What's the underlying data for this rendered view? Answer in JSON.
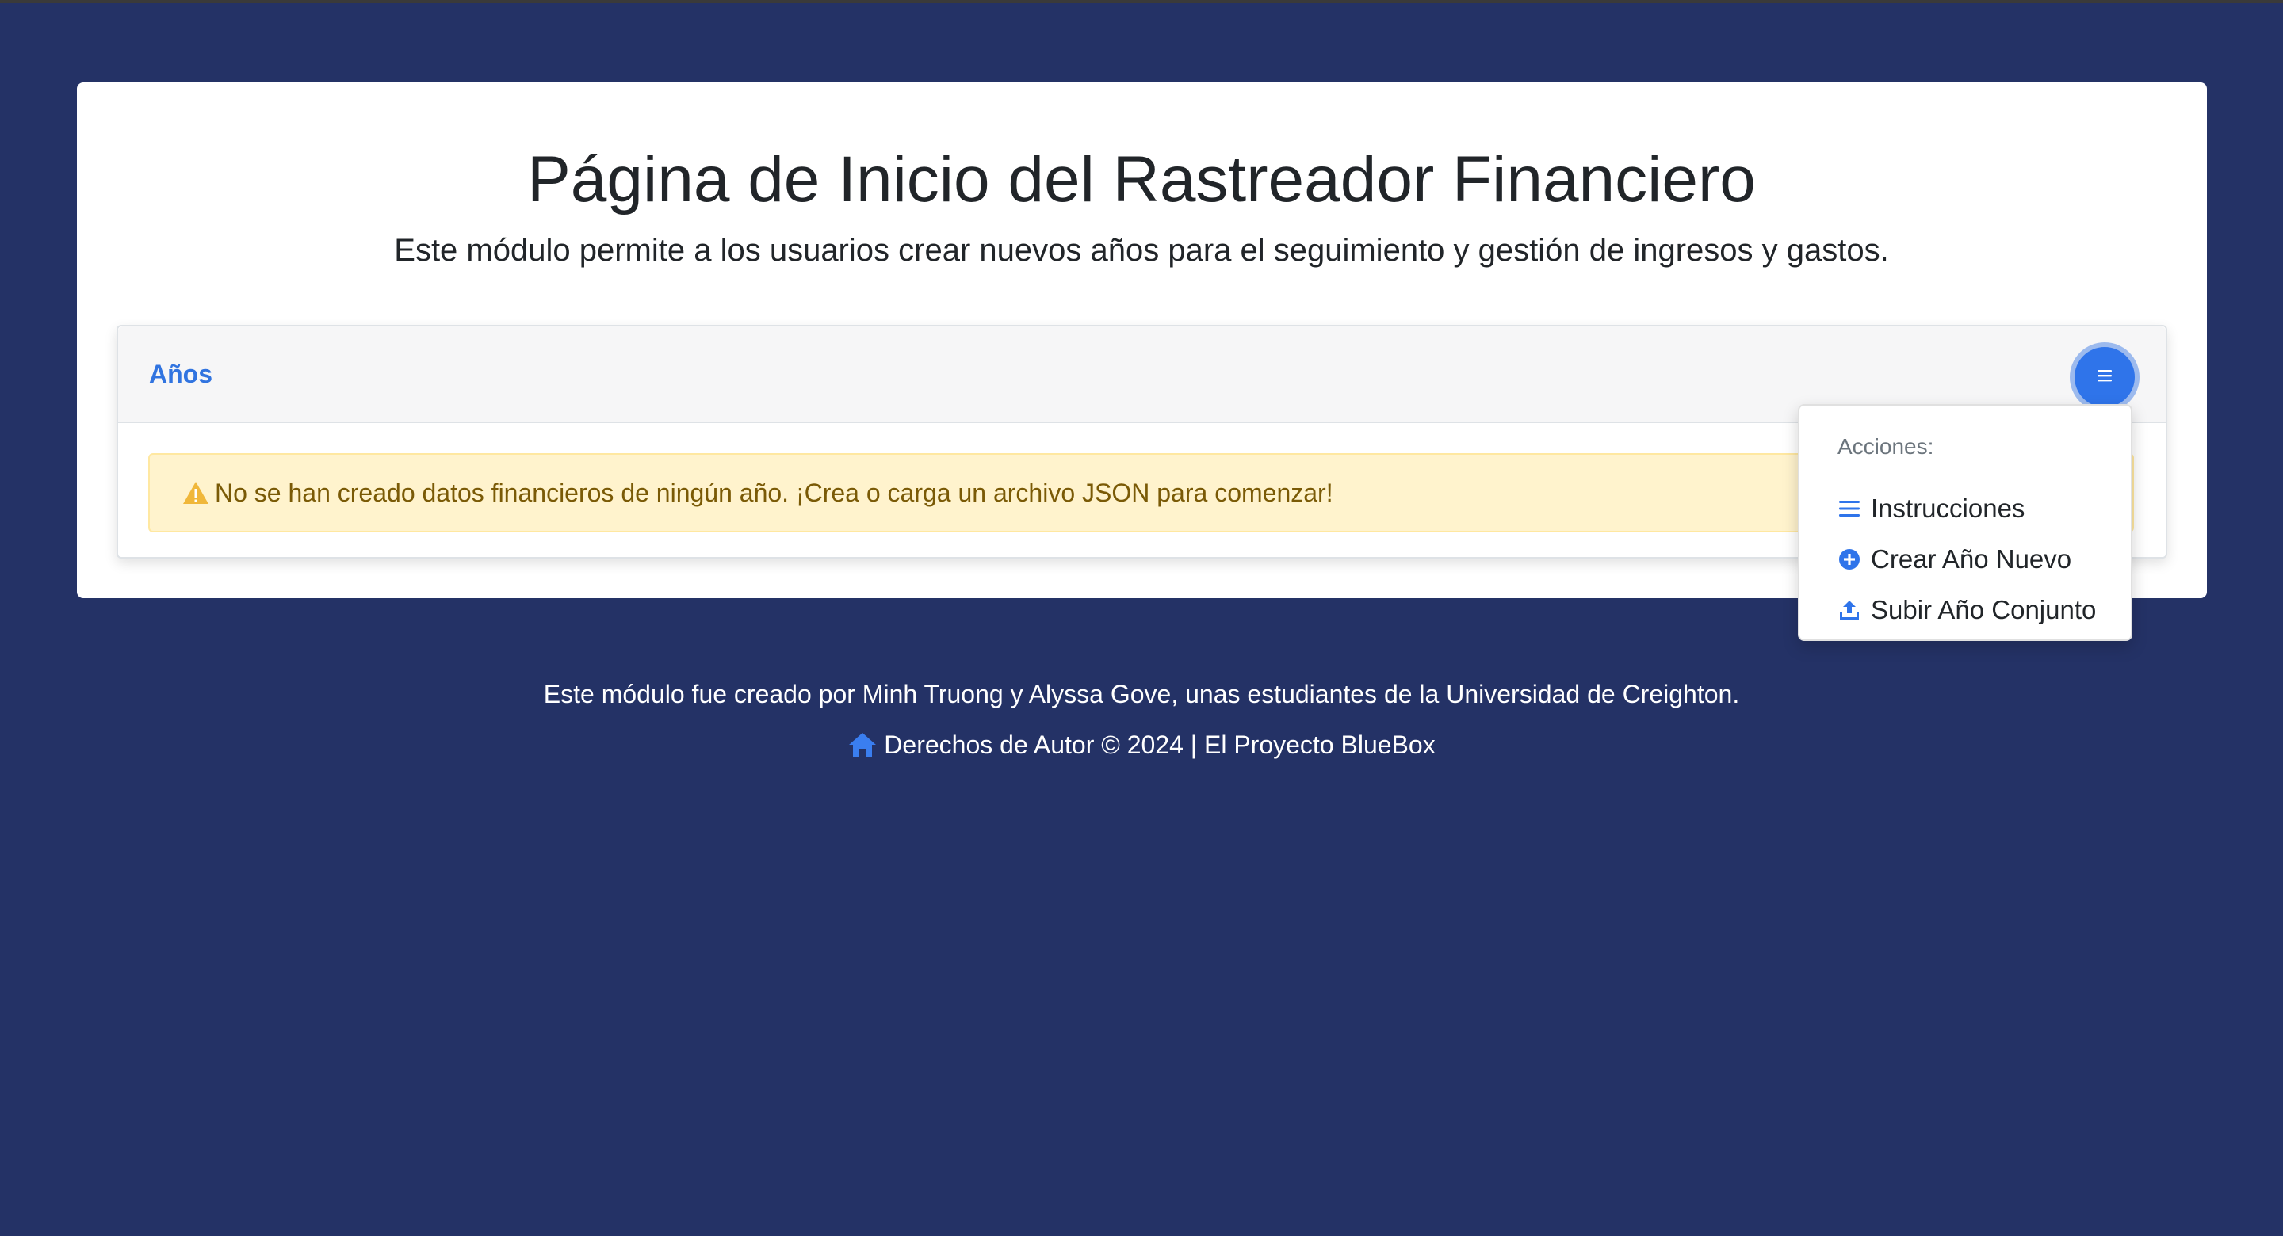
{
  "page": {
    "title": "Página de Inicio del Rastreador Financiero",
    "subtitle": "Este módulo permite a los usuarios crear nuevos años para el seguimiento y gestión de ingresos y gastos."
  },
  "years_card": {
    "title": "Años",
    "menu_icon": "list-icon",
    "alert_icon": "warning-icon",
    "alert_text": "No se han creado datos financieros de ningún año. ¡Crea o carga un archivo JSON para comenzar!"
  },
  "dropdown": {
    "header": "Acciones:",
    "items": [
      {
        "label": "Instrucciones",
        "icon": "list-icon"
      },
      {
        "label": "Crear Año Nuevo",
        "icon": "plus-circle-icon"
      },
      {
        "label": "Subir Año Conjunto",
        "icon": "upload-icon"
      }
    ]
  },
  "footer": {
    "credit": "Este módulo fue creado por Minh Truong y Alyssa Gove, unas estudiantes de la Universidad de Creighton.",
    "home_icon": "home-icon",
    "copyright": "Derechos de Autor © 2024 | El Proyecto BlueBox"
  },
  "colors": {
    "background": "#243266",
    "accent": "#2f74ea",
    "alert_bg": "#fff3cd",
    "alert_text": "#7a5a06",
    "title_link": "#3174e0"
  }
}
